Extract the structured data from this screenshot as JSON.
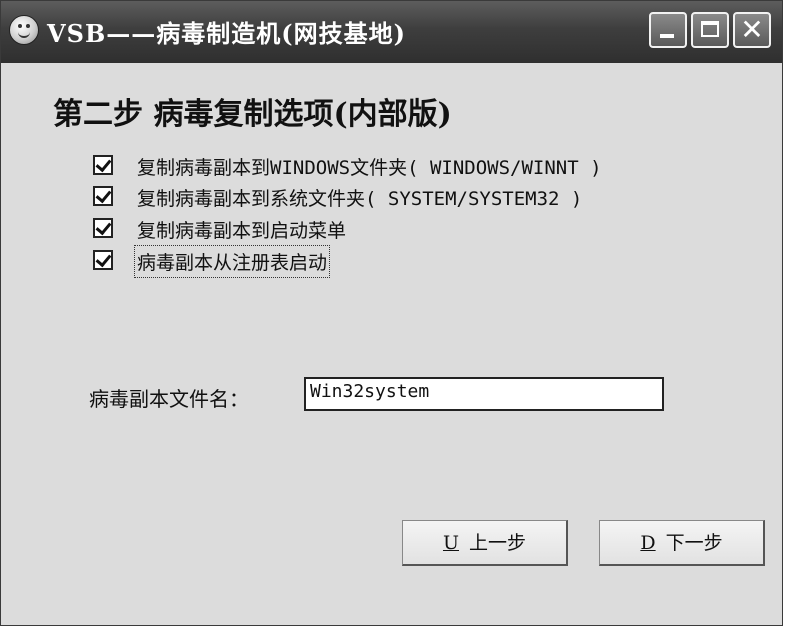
{
  "window": {
    "title": "VSB——病毒制造机(网技基地)"
  },
  "heading": "第二步 病毒复制选项(内部版)",
  "options": [
    {
      "label": "复制病毒副本到WINDOWS文件夹( WINDOWS/WINNT )",
      "checked": true
    },
    {
      "label": "复制病毒副本到系统文件夹( SYSTEM/SYSTEM32 )",
      "checked": true
    },
    {
      "label": "复制病毒副本到启动菜单",
      "checked": true
    },
    {
      "label": "病毒副本从注册表启动",
      "checked": true
    }
  ],
  "filename": {
    "label": "病毒副本文件名：",
    "value": "Win32system"
  },
  "buttons": {
    "prev": {
      "key": "U",
      "label": "上一步"
    },
    "next": {
      "key": "D",
      "label": "下一步"
    }
  }
}
